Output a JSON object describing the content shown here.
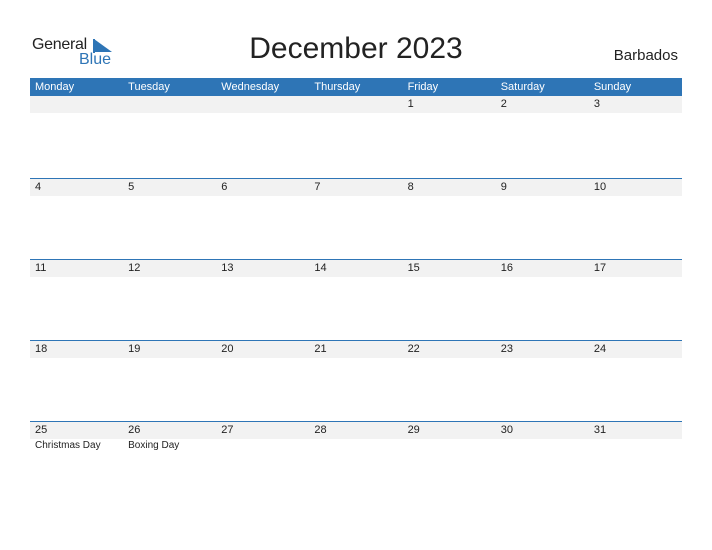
{
  "logo": {
    "general": "General",
    "blue": "Blue"
  },
  "title": "December 2023",
  "country": "Barbados",
  "colors": {
    "accent": "#2e75b6",
    "band": "#f2f2f2"
  },
  "weekdays": [
    "Monday",
    "Tuesday",
    "Wednesday",
    "Thursday",
    "Friday",
    "Saturday",
    "Sunday"
  ],
  "weeks": [
    {
      "days": [
        "",
        "",
        "",
        "",
        "1",
        "2",
        "3"
      ],
      "notes": [
        "",
        "",
        "",
        "",
        "",
        "",
        ""
      ]
    },
    {
      "days": [
        "4",
        "5",
        "6",
        "7",
        "8",
        "9",
        "10"
      ],
      "notes": [
        "",
        "",
        "",
        "",
        "",
        "",
        ""
      ]
    },
    {
      "days": [
        "11",
        "12",
        "13",
        "14",
        "15",
        "16",
        "17"
      ],
      "notes": [
        "",
        "",
        "",
        "",
        "",
        "",
        ""
      ]
    },
    {
      "days": [
        "18",
        "19",
        "20",
        "21",
        "22",
        "23",
        "24"
      ],
      "notes": [
        "",
        "",
        "",
        "",
        "",
        "",
        ""
      ]
    },
    {
      "days": [
        "25",
        "26",
        "27",
        "28",
        "29",
        "30",
        "31"
      ],
      "notes": [
        "Christmas Day",
        "Boxing Day",
        "",
        "",
        "",
        "",
        ""
      ]
    }
  ]
}
